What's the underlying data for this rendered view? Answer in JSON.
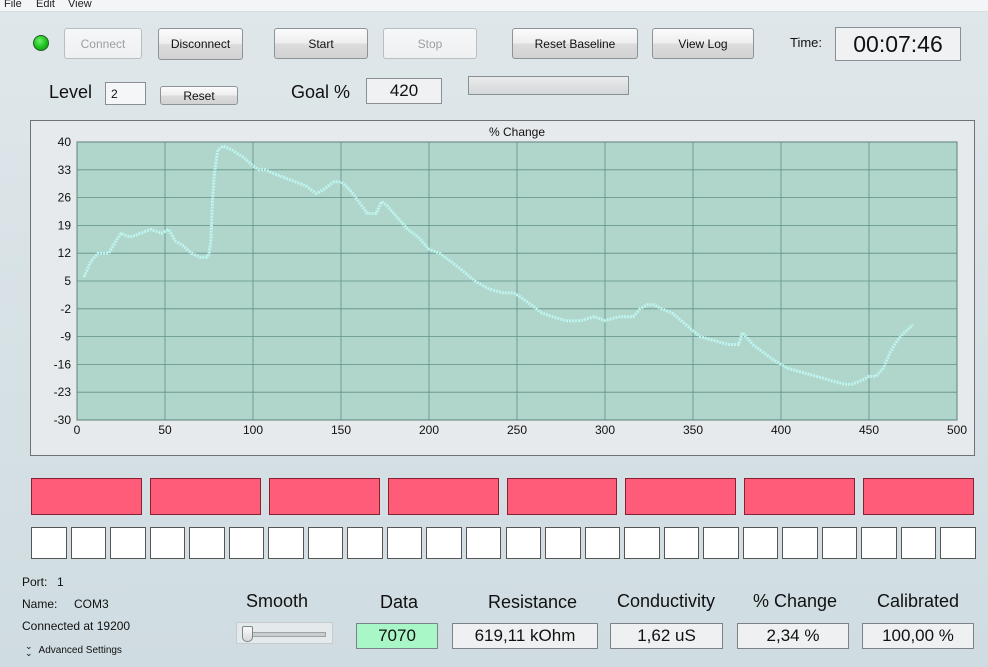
{
  "menu": [
    "File",
    "Edit",
    "View"
  ],
  "toolbar": {
    "connect": "Connect",
    "disconnect": "Disconnect",
    "start": "Start",
    "stop": "Stop",
    "reset_baseline": "Reset Baseline",
    "view_log": "View Log",
    "time_label": "Time:",
    "time_value": "00:07:46"
  },
  "level": {
    "label": "Level",
    "value": "2",
    "reset": "Reset"
  },
  "goal": {
    "label": "Goal %",
    "value": "420",
    "progress": 0
  },
  "status_colors": {
    "led": "#1fc41f",
    "tile_active": "#ff5c7a",
    "plot_bg": "#b0d6cc",
    "trace": "#bff5f0"
  },
  "chart_data": {
    "type": "line",
    "title": "% Change",
    "xlabel": "",
    "ylabel": "",
    "xlim": [
      0,
      500
    ],
    "ylim": [
      -30,
      40
    ],
    "xticks": [
      0,
      50,
      100,
      150,
      200,
      250,
      300,
      350,
      400,
      450,
      500
    ],
    "yticks": [
      40,
      33,
      26,
      19,
      12,
      5,
      -2,
      -9,
      -16,
      -23,
      -30
    ],
    "grid": true,
    "series": [
      {
        "x": [
          4,
          8,
          12,
          18,
          22,
          25,
          30,
          36,
          42,
          48,
          52,
          56,
          60,
          65,
          70,
          74,
          75,
          76,
          77,
          78,
          80,
          83,
          88,
          95,
          100,
          103,
          107,
          112,
          118,
          124,
          130,
          136,
          140,
          143,
          146,
          150,
          155,
          160,
          165,
          170,
          173,
          176,
          182,
          188,
          194,
          200,
          206,
          212,
          218,
          226,
          234,
          242,
          248,
          252,
          258,
          264,
          270,
          278,
          286,
          294,
          300,
          308,
          316,
          320,
          324,
          328,
          332,
          338,
          346,
          354,
          362,
          370,
          376,
          378,
          384,
          390,
          396,
          404,
          412,
          420,
          428,
          436,
          440,
          446,
          450,
          454,
          458,
          462,
          466,
          470,
          475
        ],
        "y": [
          6,
          10,
          12,
          12,
          15,
          17,
          16,
          17,
          18,
          17,
          18,
          15,
          14,
          12,
          11,
          11,
          12,
          15,
          25,
          32,
          38,
          39,
          38,
          36,
          34,
          33,
          33,
          32,
          31,
          30,
          29,
          27,
          28,
          29,
          30,
          30,
          28,
          25,
          22,
          22,
          25,
          24,
          21,
          18,
          16,
          13,
          12,
          10,
          8,
          5,
          3,
          2,
          2,
          1,
          -1,
          -3,
          -4,
          -5,
          -5,
          -4,
          -5,
          -4,
          -4,
          -2,
          -1,
          -1,
          -2,
          -3,
          -6,
          -9,
          -10,
          -11,
          -11,
          -8,
          -11,
          -13,
          -15,
          -17,
          -18,
          -19,
          -20,
          -21,
          -21,
          -20,
          -19,
          -19,
          -17,
          -13,
          -10,
          -8,
          -6
        ]
      }
    ]
  },
  "tiles": {
    "red_count": 8,
    "white_count": 24
  },
  "port": {
    "port_label": "Port:",
    "port_value": "1",
    "name_label": "Name:",
    "name_value": "COM3",
    "connected": "Connected at 19200",
    "advanced": "Advanced Settings"
  },
  "readouts": {
    "smooth_label": "Smooth",
    "data_label": "Data",
    "data_value": "7070",
    "resistance_label": "Resistance",
    "resistance_value": "619,11 kOhm",
    "conductivity_label": "Conductivity",
    "conductivity_value": "1,62 uS",
    "change_label": "% Change",
    "change_value": "2,34 %",
    "calibrated_label": "Calibrated",
    "calibrated_value": "100,00 %"
  }
}
